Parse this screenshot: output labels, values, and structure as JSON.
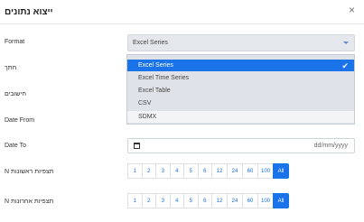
{
  "dialog": {
    "title": "ייצוא נתונים",
    "close_label": "×"
  },
  "fields": {
    "format_label": "Format",
    "split_label": "חתך",
    "calc_label": "חישובים",
    "date_from_label": "Date From",
    "date_to_label": "Date To",
    "first_obs_label": "N תצפיות ראשונות",
    "last_obs_label": "N תצפיות אחרונות"
  },
  "format_select": {
    "value": "Excel Series",
    "options": [
      "Excel Series",
      "Excel Time Series",
      "Excel Table",
      "CSV",
      "SDMX"
    ],
    "selected_index": 0
  },
  "date_to_input": {
    "placeholder": "dd/mm/yyyy"
  },
  "first_obs_buttons": [
    "1",
    "2",
    "3",
    "4",
    "5",
    "6",
    "12",
    "24",
    "60",
    "100",
    "All"
  ],
  "last_obs_buttons": [
    "1",
    "2",
    "3",
    "4",
    "5",
    "6",
    "12",
    "24",
    "60",
    "100",
    "All"
  ],
  "colors": {
    "accent": "#1a73e8",
    "select_bg": "#e4e7eb",
    "dropdown_bg": "#dfe3e9"
  },
  "icons": {
    "close": "close-icon",
    "check": "check-icon",
    "calendar": "calendar-icon",
    "caret": "chevron-down-icon"
  }
}
